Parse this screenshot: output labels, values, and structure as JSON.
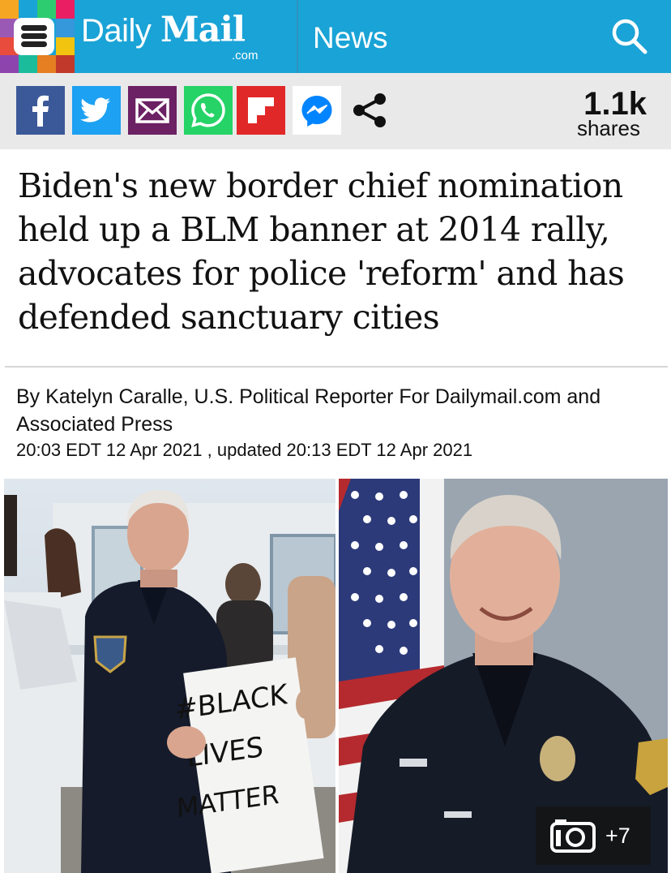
{
  "header": {
    "logo_daily": "Daily",
    "logo_mail": "Mail",
    "logo_com": ".com",
    "section": "News",
    "brand_color": "#1aa3d6"
  },
  "share_bar": {
    "buttons": [
      {
        "name": "facebook",
        "glyph": "f",
        "color": "#3b5998"
      },
      {
        "name": "twitter",
        "glyph": "twitter-bird",
        "color": "#1da1f2"
      },
      {
        "name": "email",
        "glyph": "envelope",
        "color": "#6b2163"
      },
      {
        "name": "whatsapp",
        "glyph": "phone",
        "color": "#25d366"
      },
      {
        "name": "flipboard",
        "glyph": "F",
        "color": "#e12828"
      },
      {
        "name": "messenger",
        "glyph": "bolt",
        "color": "#0084ff"
      },
      {
        "name": "share",
        "glyph": "share-nodes",
        "color": "#111111"
      }
    ],
    "count": "1.1k",
    "count_label": "shares"
  },
  "article": {
    "headline": "Biden's new border chief nomination held up a BLM banner at 2014 rally, advocates for police 'reform' and has defended sanctuary cities",
    "byline": "By Katelyn Caralle, U.S. Political Reporter For Dailymail.com and Associated Press",
    "published": "20:03 EDT 12 Apr 2021",
    "updated_prefix": ", updated",
    "updated": "20:13 EDT 12 Apr 2021"
  },
  "images": {
    "left_sign_text": [
      "#BLACK",
      "LIVES",
      "MATTER"
    ],
    "gallery_count": "+7"
  }
}
